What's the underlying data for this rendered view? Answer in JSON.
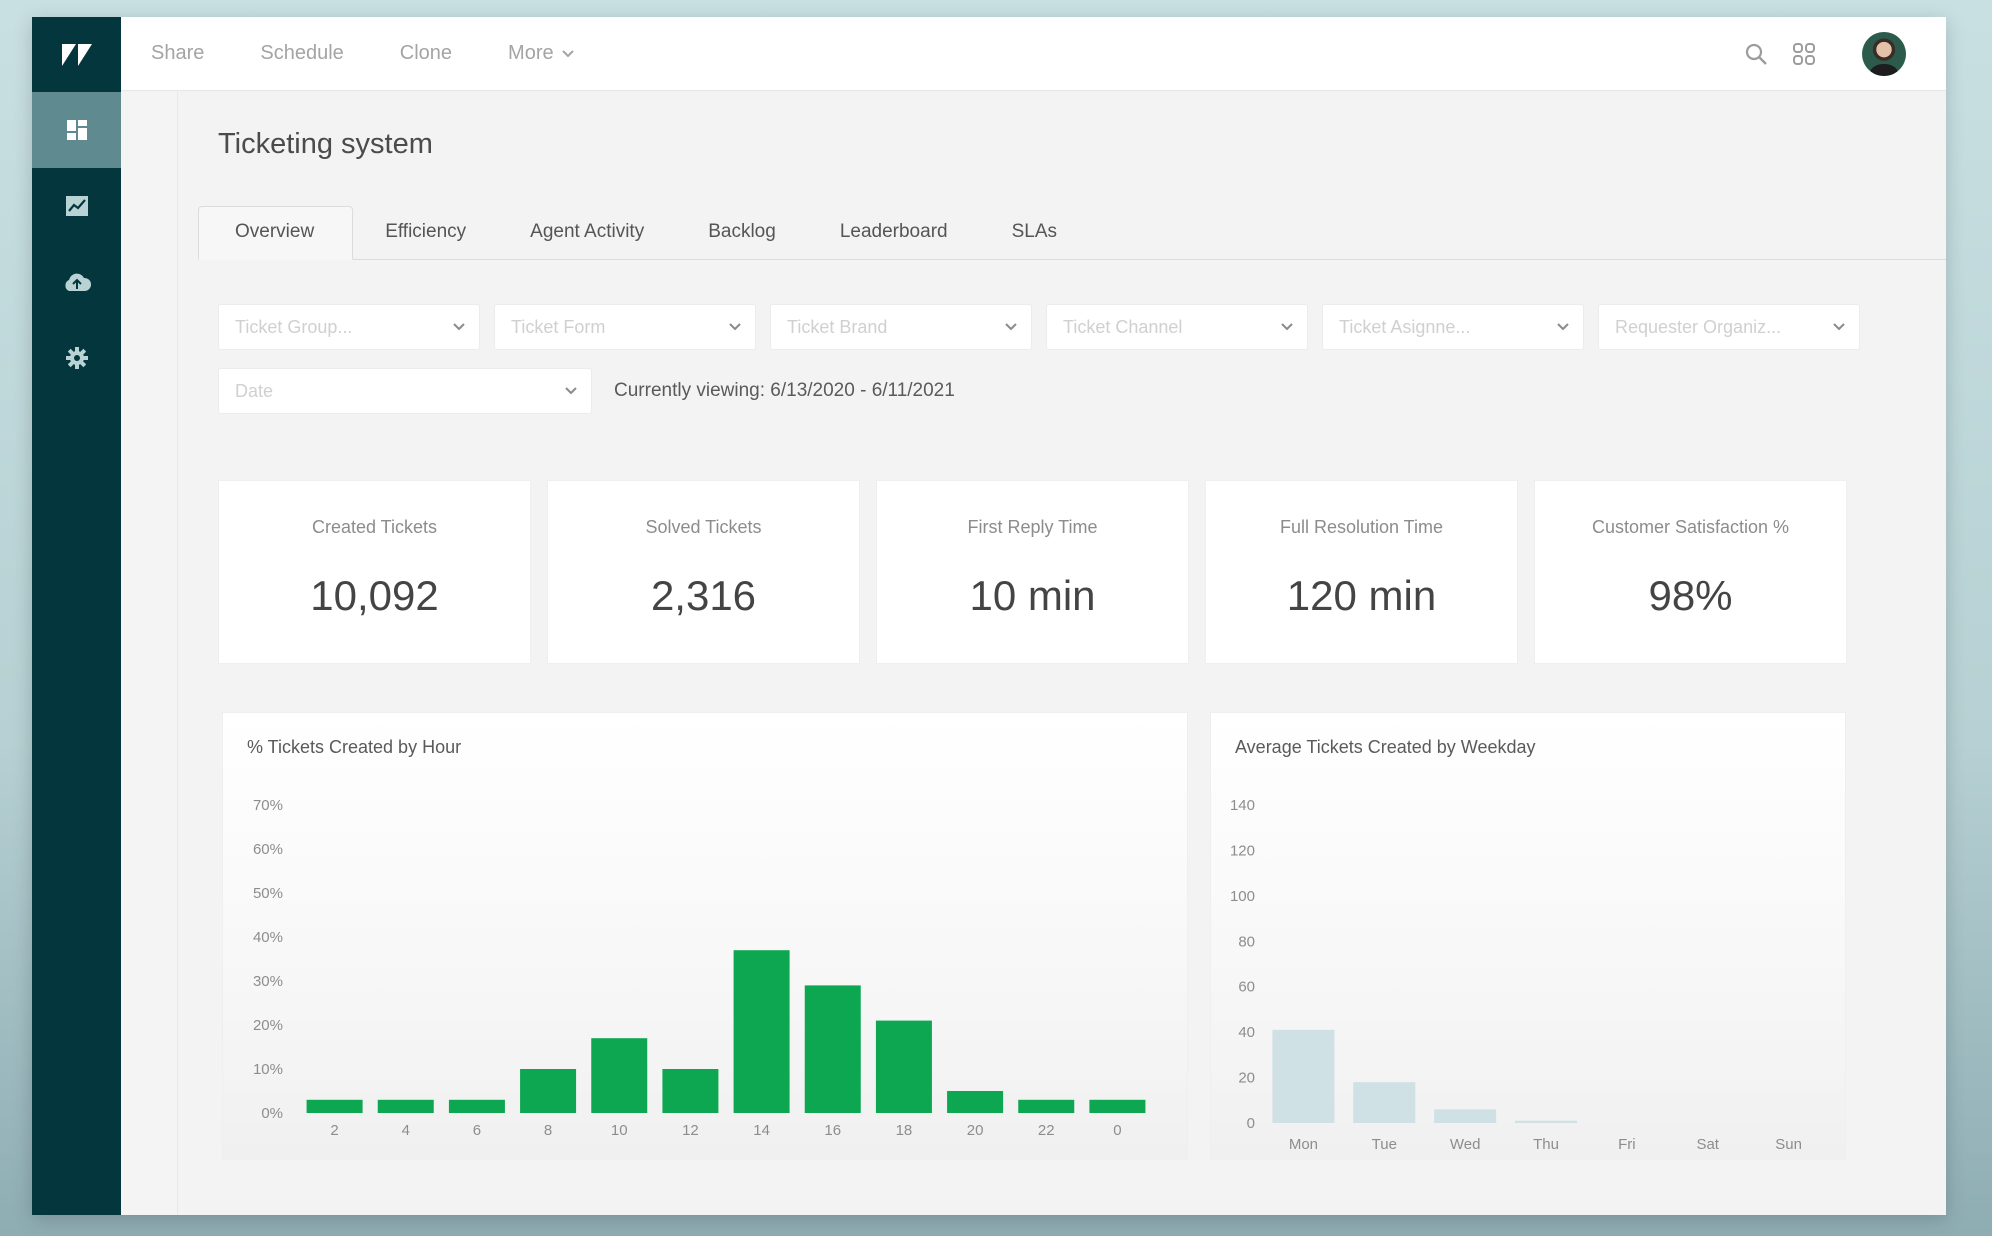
{
  "app": {
    "logo_glyph": "Z",
    "logo_icon": "zendesk-logo"
  },
  "sidebar": {
    "items": [
      {
        "icon": "dashboard-icon",
        "active": true
      },
      {
        "icon": "reports-chart-icon",
        "active": false
      },
      {
        "icon": "cloud-upload-icon",
        "active": false
      },
      {
        "icon": "gear-icon",
        "active": false
      }
    ]
  },
  "topbar": {
    "actions": [
      "Share",
      "Schedule",
      "Clone",
      "More"
    ],
    "icons": [
      "search-icon",
      "apps-grid-icon"
    ],
    "avatar": "user-avatar"
  },
  "page": {
    "title": "Ticketing system",
    "tabs": [
      {
        "label": "Overview",
        "active": true
      },
      {
        "label": "Efficiency",
        "active": false
      },
      {
        "label": "Agent Activity",
        "active": false
      },
      {
        "label": "Backlog",
        "active": false
      },
      {
        "label": "Leaderboard",
        "active": false
      },
      {
        "label": "SLAs",
        "active": false
      }
    ]
  },
  "filters": {
    "selects": [
      {
        "placeholder": "Ticket Group..."
      },
      {
        "placeholder": "Ticket Form"
      },
      {
        "placeholder": "Ticket Brand"
      },
      {
        "placeholder": "Ticket Channel"
      },
      {
        "placeholder": "Ticket Asignne..."
      },
      {
        "placeholder": "Requester Organiz..."
      }
    ],
    "date_placeholder": "Date",
    "currently_viewing": "Currently viewing: 6/13/2020 - 6/11/2021"
  },
  "kpis": [
    {
      "label": "Created Tickets",
      "value": "10,092"
    },
    {
      "label": "Solved Tickets",
      "value": "2,316"
    },
    {
      "label": "First Reply Time",
      "value": "10 min"
    },
    {
      "label": "Full Resolution Time",
      "value": "120 min"
    },
    {
      "label": "Customer Satisfaction %",
      "value": "98%"
    }
  ],
  "colors": {
    "sidebar": "#03363d",
    "sidebar_active": "#5f8a8f",
    "bar_green": "#0ca750",
    "bar_light_blue": "#cfe1e5"
  },
  "chart_data": [
    {
      "type": "bar",
      "title": "% Tickets Created by Hour",
      "xlabel": "",
      "ylabel": "",
      "categories": [
        "2",
        "4",
        "6",
        "8",
        "10",
        "12",
        "14",
        "16",
        "18",
        "20",
        "22",
        "0"
      ],
      "values": [
        3,
        3,
        3,
        10,
        17,
        10,
        37,
        29,
        21,
        5,
        3,
        3
      ],
      "ylim": [
        0,
        70
      ],
      "yticks": [
        "0%",
        "10%",
        "20%",
        "30%",
        "40%",
        "50%",
        "60%",
        "70%"
      ],
      "grid": false,
      "legend": "none"
    },
    {
      "type": "bar",
      "title": "Average Tickets Created by Weekday",
      "xlabel": "",
      "ylabel": "",
      "categories": [
        "Mon",
        "Tue",
        "Wed",
        "Thu",
        "Fri",
        "Sat",
        "Sun"
      ],
      "values": [
        41,
        18,
        6,
        1,
        0,
        0,
        0
      ],
      "ylim": [
        0,
        140
      ],
      "yticks": [
        "0",
        "20",
        "40",
        "60",
        "80",
        "100",
        "120",
        "140"
      ],
      "grid": false,
      "legend": "none"
    }
  ]
}
